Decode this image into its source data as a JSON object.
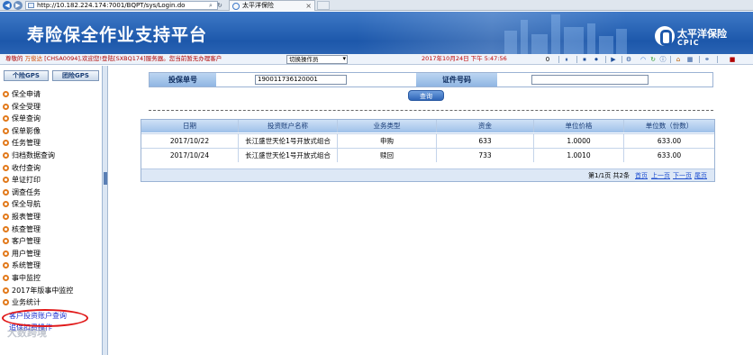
{
  "browser": {
    "address": "http://10.182.224.174:7001/BQPT/sys/Login.do",
    "tab_title": "太平洋保险"
  },
  "banner": {
    "title": "寿险保全作业支持平台",
    "logo_cn": "太平洋保险",
    "logo_en": "CPIC"
  },
  "infobar": {
    "welcome_prefix": "尊敬的",
    "user_name": "万俊达",
    "welcome_suffix": "[CHSA0094],欢迎您!登陆[SXBQ174]服务器。您当前暂无办理客户",
    "role_select": "切换操作员",
    "datetime": "2017年10月24日 下午 5:47:56",
    "count": "0"
  },
  "sidebar": {
    "tabs": [
      "个险GPS",
      "团险GPS"
    ],
    "items": [
      "保全申请",
      "保全受理",
      "保单查询",
      "保单影像",
      "任务管理",
      "归档数据查询",
      "收付查询",
      "单证打印",
      "调查任务",
      "保全导航",
      "报表管理",
      "核查管理",
      "客户管理",
      "用户管理",
      "系统管理",
      "事中监控",
      "2017年版事中监控",
      "业务统计"
    ],
    "sub_items": [
      "客户投资账户查询",
      "追保扣费操作"
    ],
    "watermark": "大数跨境"
  },
  "query": {
    "policy_label": "投保单号",
    "policy_value": "190011736120001",
    "cert_label": "证件号码",
    "cert_value": "",
    "search_label": "查询"
  },
  "table": {
    "columns": [
      "日期",
      "投资账户名称",
      "业务类型",
      "资金",
      "单位价格",
      "单位数（份数）"
    ],
    "rows": [
      [
        "2017/10/22",
        "长江盛世天伦1号开放式组合",
        "申购",
        "633",
        "1.0000",
        "633.00"
      ],
      [
        "2017/10/24",
        "长江盛世天伦1号开放式组合",
        "赎回",
        "733",
        "1.0010",
        "633.00"
      ]
    ],
    "pager": {
      "info": "第1/1页 共2条",
      "first": "首页",
      "prev": "上一页",
      "next": "下一页",
      "last": "尾页"
    }
  },
  "colors": {
    "banner": "#1d58ab",
    "accent_red": "#c00000",
    "menu_dot": "#e27a1c",
    "highlight": "#e01818"
  }
}
